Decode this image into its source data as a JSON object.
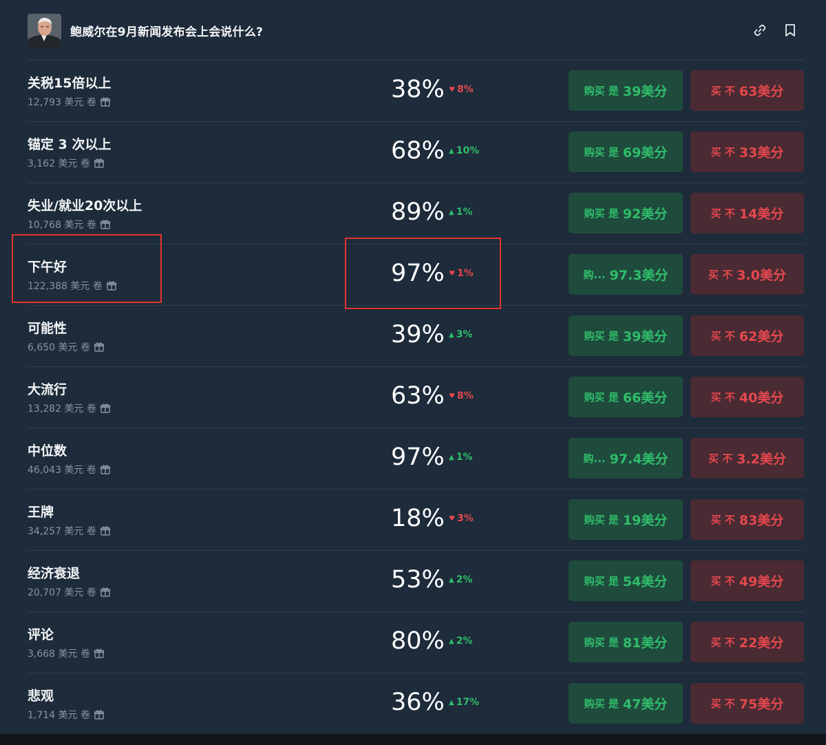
{
  "header": {
    "title": "鲍威尔在9月新闻发布会上会说什么?",
    "avatar_icon": "person-avatar-icon",
    "link_icon": "link-icon",
    "bookmark_icon": "bookmark-icon"
  },
  "colors": {
    "background": "#1d2b3a",
    "up": "#2fbd6a",
    "down": "#e5484d",
    "buy_yes_bg": "#1f4b3d",
    "buy_no_bg": "#4a2a33",
    "highlight": "#e5342d"
  },
  "markets": [
    {
      "name": "关税15倍以上",
      "volume": "12,793 美元 卷",
      "pct": "38%",
      "change": "8%",
      "direction": "down",
      "yes_label": "购买 是",
      "yes_price": "39美分",
      "no_label": "买 不",
      "no_price": "63美分"
    },
    {
      "name": "锚定 3 次以上",
      "volume": "3,162 美元 卷",
      "pct": "68%",
      "change": "10%",
      "direction": "up",
      "yes_label": "购买 是",
      "yes_price": "69美分",
      "no_label": "买 不",
      "no_price": "33美分"
    },
    {
      "name": "失业/就业20次以上",
      "volume": "10,768 美元 卷",
      "pct": "89%",
      "change": "1%",
      "direction": "up",
      "yes_label": "购买 是",
      "yes_price": "92美分",
      "no_label": "买 不",
      "no_price": "14美分"
    },
    {
      "name": "下午好",
      "volume": "122,388 美元 卷",
      "pct": "97%",
      "change": "1%",
      "direction": "down",
      "yes_label": "购...",
      "yes_price": "97.3美分",
      "no_label": "买 不",
      "no_price": "3.0美分"
    },
    {
      "name": "可能性",
      "volume": "6,650 美元 卷",
      "pct": "39%",
      "change": "3%",
      "direction": "up",
      "yes_label": "购买 是",
      "yes_price": "39美分",
      "no_label": "买 不",
      "no_price": "62美分"
    },
    {
      "name": "大流行",
      "volume": "13,282 美元 卷",
      "pct": "63%",
      "change": "8%",
      "direction": "down",
      "yes_label": "购买 是",
      "yes_price": "66美分",
      "no_label": "买 不",
      "no_price": "40美分"
    },
    {
      "name": "中位数",
      "volume": "46,043 美元 卷",
      "pct": "97%",
      "change": "1%",
      "direction": "up",
      "yes_label": "购...",
      "yes_price": "97.4美分",
      "no_label": "买 不",
      "no_price": "3.2美分"
    },
    {
      "name": "王牌",
      "volume": "34,257 美元 卷",
      "pct": "18%",
      "change": "3%",
      "direction": "down",
      "yes_label": "购买 是",
      "yes_price": "19美分",
      "no_label": "买 不",
      "no_price": "83美分"
    },
    {
      "name": "经济衰退",
      "volume": "20,707 美元 卷",
      "pct": "53%",
      "change": "2%",
      "direction": "up",
      "yes_label": "购买 是",
      "yes_price": "54美分",
      "no_label": "买 不",
      "no_price": "49美分"
    },
    {
      "name": "评论",
      "volume": "3,668 美元 卷",
      "pct": "80%",
      "change": "2%",
      "direction": "up",
      "yes_label": "购买 是",
      "yes_price": "81美分",
      "no_label": "买 不",
      "no_price": "22美分"
    },
    {
      "name": "悲观",
      "volume": "1,714 美元 卷",
      "pct": "36%",
      "change": "17%",
      "direction": "up",
      "yes_label": "购买 是",
      "yes_price": "47美分",
      "no_label": "买 不",
      "no_price": "75美分"
    }
  ]
}
